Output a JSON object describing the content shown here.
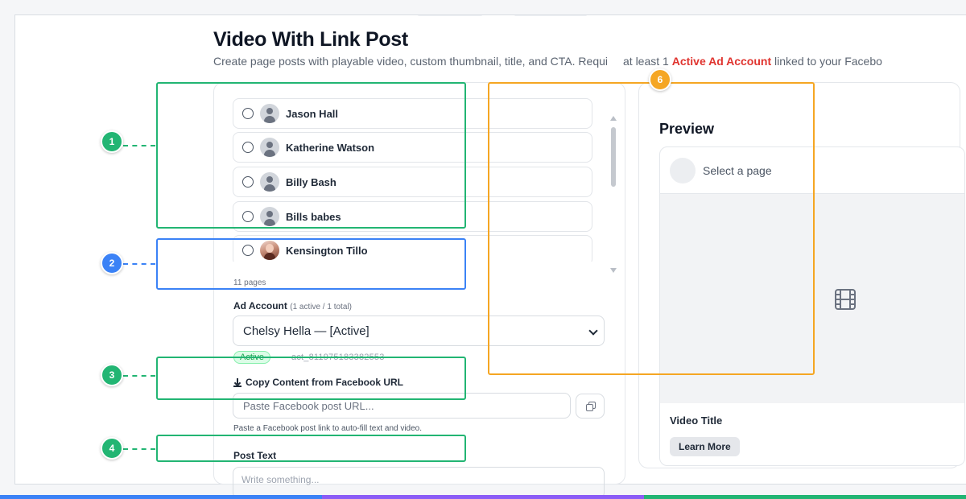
{
  "header": {
    "title": "Video With Link Post",
    "subtitle_before": "Create page posts with playable video, custom thumbnail, title, and CTA. Requi",
    "subtitle_gap": "at least 1 ",
    "subtitle_highlight": "Active Ad Account",
    "subtitle_after": " linked to your Facebo"
  },
  "pages": {
    "items": [
      {
        "name": "Jason Hall",
        "avatar": "default-avatar-icon"
      },
      {
        "name": "Katherine Watson",
        "avatar": "default-avatar-icon"
      },
      {
        "name": "Billy Bash",
        "avatar": "default-avatar-icon"
      },
      {
        "name": "Bills babes",
        "avatar": "default-avatar-icon"
      },
      {
        "name": "Kensington Tillo",
        "avatar": "photo-avatar"
      }
    ],
    "count_label": "11 pages"
  },
  "ad_account": {
    "label": "Ad Account",
    "summary": "(1 active / 1 total)",
    "selected": "Chelsy Hella — [Active]",
    "status_badge": "Active",
    "account_id": "act_811975183382553"
  },
  "copy_content": {
    "heading": "Copy Content from Facebook URL",
    "placeholder": "Paste Facebook post URL...",
    "hint": "Paste a Facebook post link to auto-fill text and video."
  },
  "post_text": {
    "label": "Post Text",
    "placeholder": "Write something..."
  },
  "preview": {
    "title": "Preview",
    "page_placeholder": "Select a page",
    "video_title": "Video Title",
    "cta_label": "Learn More"
  },
  "annotations": [
    {
      "number": "1",
      "color": "#22b573"
    },
    {
      "number": "2",
      "color": "#3b82f6"
    },
    {
      "number": "3",
      "color": "#22b573"
    },
    {
      "number": "4",
      "color": "#22b573"
    },
    {
      "number": "6",
      "color": "#f5a623"
    }
  ],
  "colors": {
    "accent_red": "#e0342f",
    "active_green": "#16a34a",
    "bottom_bar": [
      "#3b82f6",
      "#8b5cf6",
      "#22b573"
    ]
  }
}
